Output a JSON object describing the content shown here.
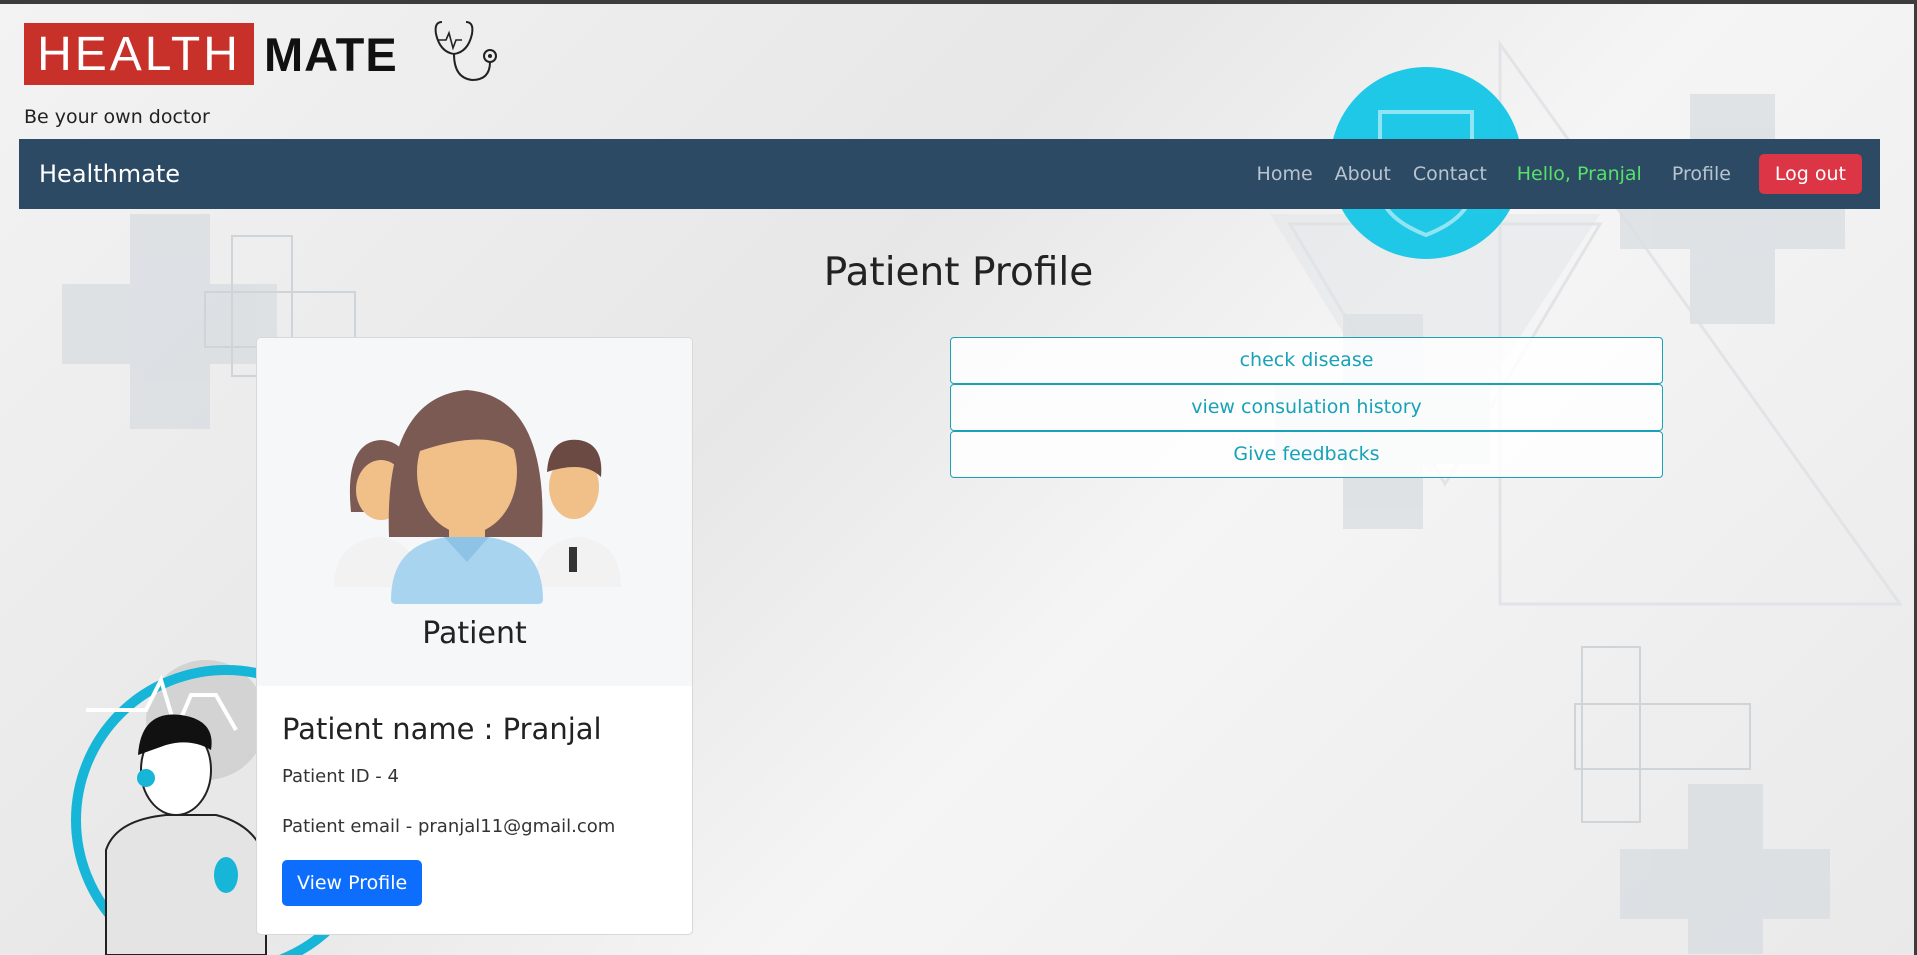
{
  "header": {
    "logo_part1": "HEALTH",
    "logo_part2": "MATE",
    "tagline": "Be your own doctor"
  },
  "navbar": {
    "brand": "Healthmate",
    "links": [
      "Home",
      "About",
      "Contact"
    ],
    "greeting": "Hello, Pranjal",
    "profile": "Profile",
    "logout": "Log out"
  },
  "page": {
    "title": "Patient Profile"
  },
  "card": {
    "caption": "Patient",
    "name": "Patient name : Pranjal",
    "id_text": "Patient ID - 4",
    "email_text": "Patient email - pranjal11@gmail.com",
    "button": "View Profile"
  },
  "actions": [
    "check disease",
    "view consulation history",
    "Give feedbacks"
  ],
  "colors": {
    "navbar": "#2c4a63",
    "logout": "#dc3545",
    "greeting": "#57e06b",
    "primary": "#0d6efd",
    "info": "#17a2b8",
    "logo_red": "#c8302a"
  }
}
